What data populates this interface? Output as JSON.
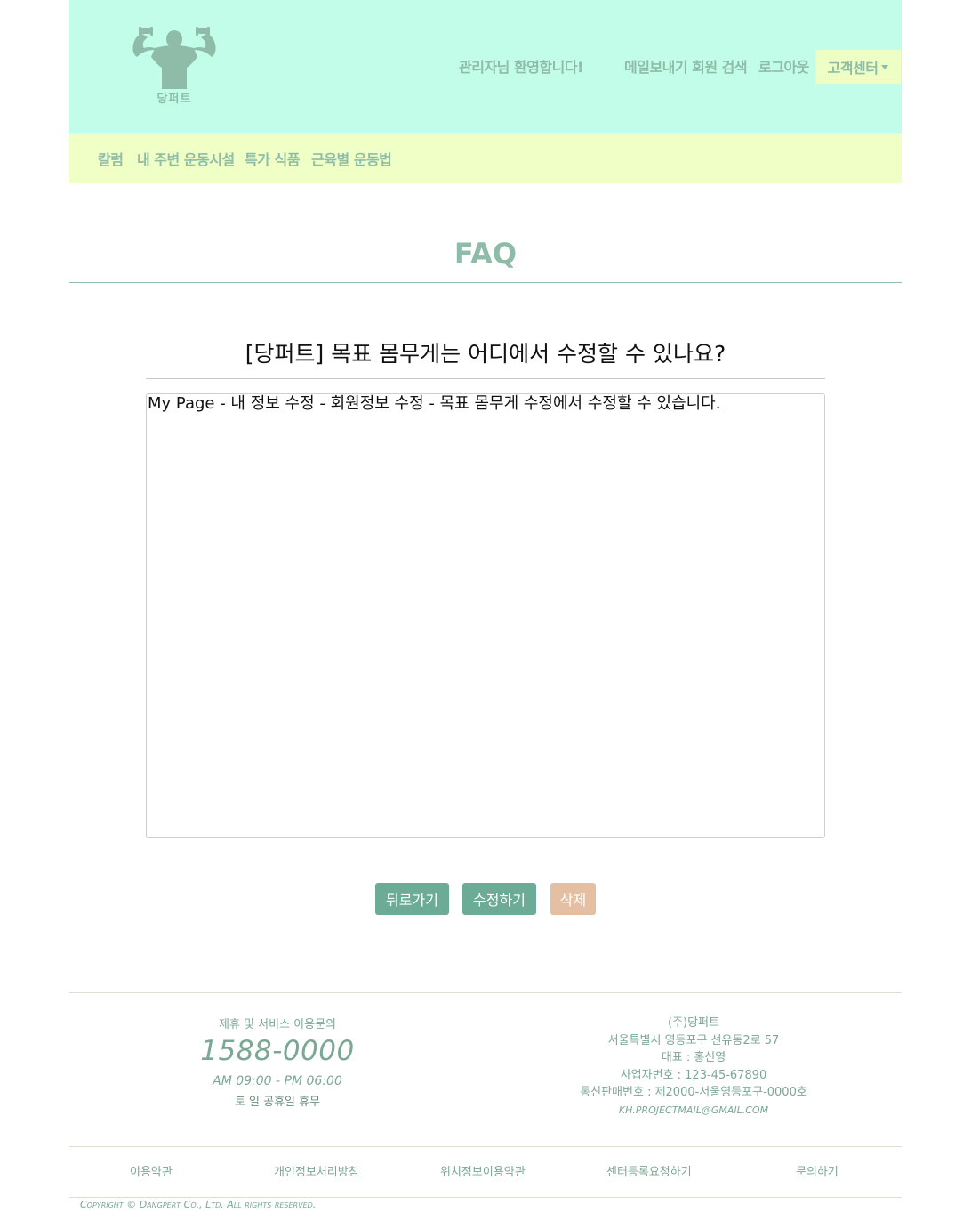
{
  "header": {
    "logo_text": "당퍼트",
    "welcome": "관리자님 환영합니다!",
    "mail_search": "메일보내기 회원 검색",
    "logout": "로그아웃",
    "customer_center": "고객센터",
    "colors": {
      "header_bg": "#c1fde9",
      "nav_bg": "#efffc5",
      "accent": "#8fbca8"
    }
  },
  "nav": {
    "items": [
      {
        "label": "칼럼"
      },
      {
        "label": "내 주변 운동시설"
      },
      {
        "label": "특가 식품"
      },
      {
        "label": "근육별 운동법"
      }
    ]
  },
  "page": {
    "title": "FAQ"
  },
  "faq": {
    "question": "[당퍼트] 목표 몸무게는 어디에서 수정할 수 있나요?",
    "answer": "My Page - 내 정보 수정 - 회원정보 수정 - 목표 몸무게 수정에서 수정할 수 있습니다."
  },
  "buttons": {
    "back": "뒤로가기",
    "edit": "수정하기",
    "delete": "삭제"
  },
  "footer": {
    "inquiry_label": "제휴 및 서비스 이용문의",
    "phone": "1588-0000",
    "hours": "AM 09:00 - PM 06:00",
    "closed": "토 일 공휴일 휴무",
    "company": "(주)당퍼트",
    "address": "서울특별시 영등포구 선유동2로 57",
    "ceo": "대표 : 홍신영",
    "business_no": "사업자번호 : 123-45-67890",
    "ecommerce_no": "통신판매번호 : 제2000-서울영등포구-0000호",
    "email": "KH.PROJECTMAIL@GMAIL.COM",
    "links": [
      "이용약관",
      "개인정보처리방침",
      "위치정보이용약관",
      "센터등록요청하기",
      "문의하기"
    ],
    "copyright": "Copyright © Dangpert Co., Ltd. All rights reserved."
  }
}
